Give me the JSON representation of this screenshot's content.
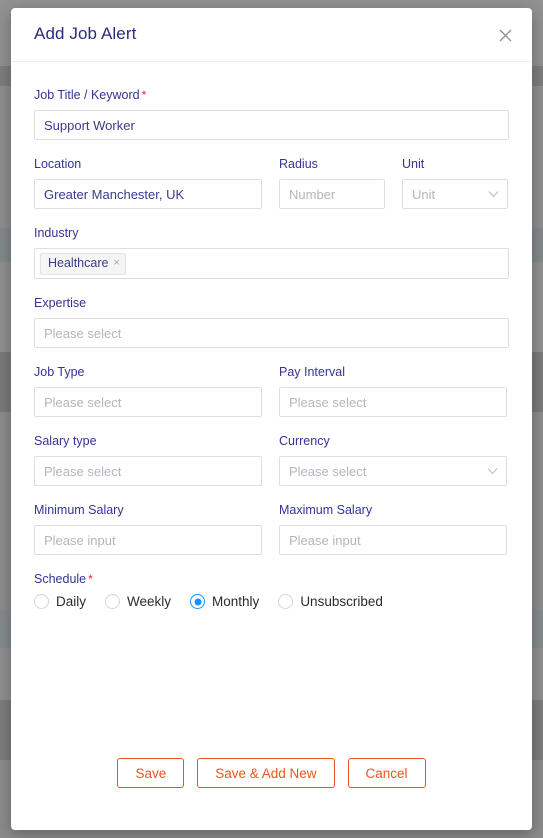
{
  "modal": {
    "title": "Add Job Alert",
    "close_icon": "close-icon"
  },
  "fields": {
    "job_title": {
      "label": "Job Title / Keyword",
      "required": true,
      "required_marker": "*",
      "value": "Support Worker"
    },
    "location": {
      "label": "Location",
      "value": "Greater Manchester, UK"
    },
    "radius": {
      "label": "Radius",
      "value": "",
      "placeholder": "Number"
    },
    "unit": {
      "label": "Unit",
      "value": "",
      "placeholder": "Unit",
      "icon": "chevron-down-icon"
    },
    "industry": {
      "label": "Industry",
      "tags": [
        {
          "label": "Healthcare",
          "remove_icon": "×"
        }
      ]
    },
    "expertise": {
      "label": "Expertise",
      "value": "",
      "placeholder": "Please select"
    },
    "job_type": {
      "label": "Job Type",
      "value": "",
      "placeholder": "Please select"
    },
    "pay_interval": {
      "label": "Pay Interval",
      "value": "",
      "placeholder": "Please select"
    },
    "salary_type": {
      "label": "Salary type",
      "value": "",
      "placeholder": "Please select"
    },
    "currency": {
      "label": "Currency",
      "value": "",
      "placeholder": "Please select",
      "icon": "chevron-down-icon"
    },
    "minimum_salary": {
      "label": "Minimum Salary",
      "value": "",
      "placeholder": "Please input"
    },
    "maximum_salary": {
      "label": "Maximum Salary",
      "value": "",
      "placeholder": "Please input"
    },
    "schedule": {
      "label": "Schedule",
      "required": true,
      "required_marker": "*",
      "selected": "Monthly",
      "options": [
        {
          "label": "Daily",
          "checked": false
        },
        {
          "label": "Weekly",
          "checked": false
        },
        {
          "label": "Monthly",
          "checked": true
        },
        {
          "label": "Unsubscribed",
          "checked": false
        }
      ]
    }
  },
  "footer": {
    "save_label": "Save",
    "save_add_new_label": "Save & Add New",
    "cancel_label": "Cancel"
  },
  "colors": {
    "title": "#2b2b80",
    "label": "#343497",
    "required": "#f5222d",
    "accent_button": "#e8561f",
    "radio_selected": "#1890ff",
    "placeholder": "#b3b6bd",
    "border": "#dcdfe3",
    "backdrop": "#8b8b8b"
  }
}
